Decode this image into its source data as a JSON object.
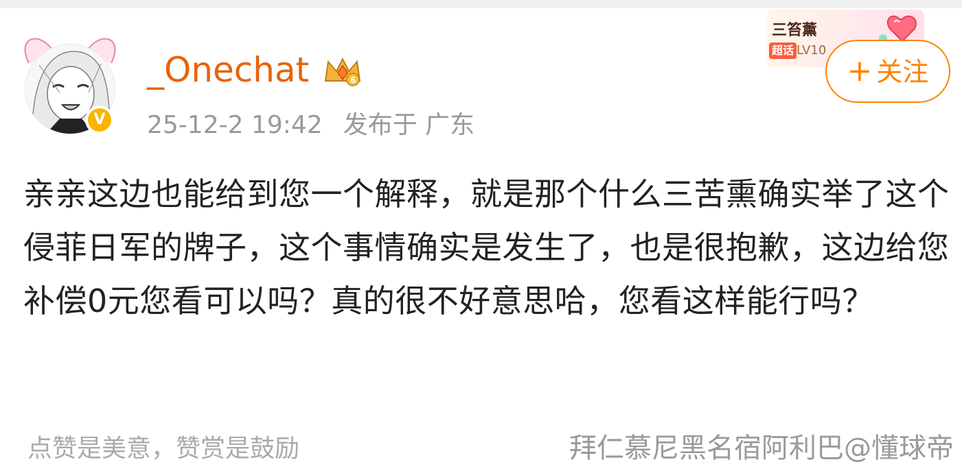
{
  "user": {
    "name": "_Onechat",
    "verified_badge": "V",
    "timestamp": "25-12-2 19:42",
    "location": "发布于 广东"
  },
  "topic_badge": {
    "name": "三笞薰",
    "tag": "超话",
    "level": "LV10"
  },
  "follow_button": {
    "plus": "+",
    "label": "关注"
  },
  "post": {
    "text": "亲亲这边也能给到您一个解释，就是那个什么三苦熏确实举了这个侵菲日军的牌子，这个事情确实是发生了，也是很抱歉，这边给您补偿0元您看可以吗？真的很不好意思哈，您看这样能行吗？"
  },
  "footer": {
    "left": "点赞是美意，赞赏是鼓励",
    "right": "拜仁慕尼黑名宿阿利巴@懂球帝"
  },
  "colors": {
    "username": "#e8630a",
    "follow": "#ff8200",
    "verified": "#f7b500",
    "text": "#222222",
    "muted": "#999999"
  }
}
